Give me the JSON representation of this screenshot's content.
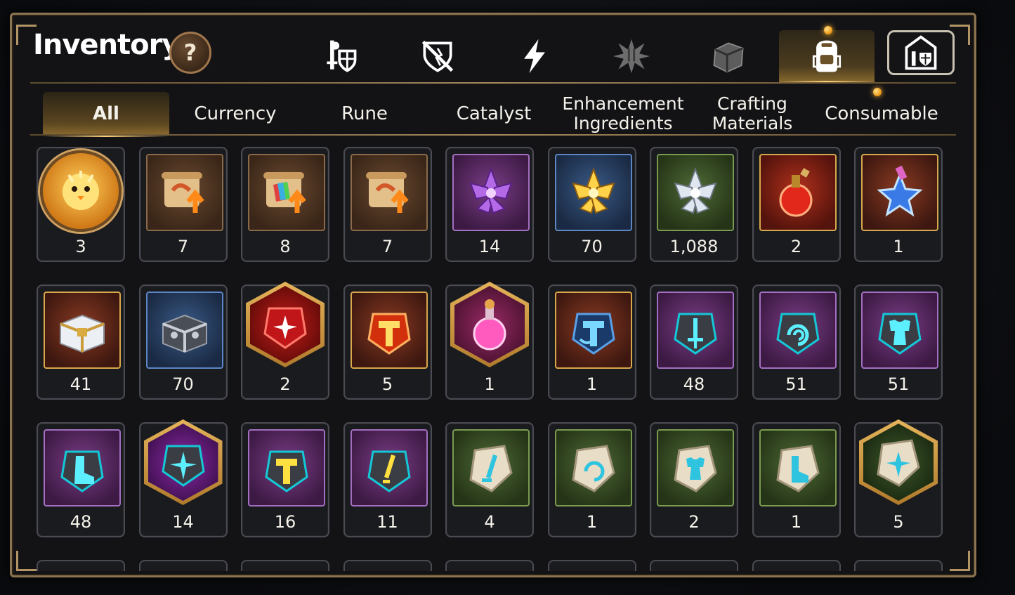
{
  "header": {
    "title": "Inventory",
    "help_label": "?"
  },
  "category_tabs": [
    {
      "name": "heroes",
      "icon": "knight-shield-icon",
      "active": false
    },
    {
      "name": "equipment",
      "icon": "broken-shield-icon",
      "active": false
    },
    {
      "name": "skills",
      "icon": "lightning-icon",
      "active": false
    },
    {
      "name": "effects",
      "icon": "burst-icon",
      "active": false
    },
    {
      "name": "boxes",
      "icon": "cube-icon",
      "active": false
    },
    {
      "name": "bag",
      "icon": "backpack-icon",
      "active": true
    },
    {
      "name": "castle",
      "icon": "castle-icon",
      "active": false
    }
  ],
  "subtabs": [
    {
      "label": "All",
      "active": true
    },
    {
      "label": "Currency",
      "active": false
    },
    {
      "label": "Rune",
      "active": false
    },
    {
      "label": "Catalyst",
      "active": false
    },
    {
      "label": "Enhancement\nIngredients",
      "active": false
    },
    {
      "label": "Crafting\nMaterials",
      "active": false
    },
    {
      "label": "Consumable",
      "active": false
    }
  ],
  "items": [
    {
      "icon": "chick-medal-icon",
      "count": "3",
      "frame": "round"
    },
    {
      "icon": "scroll-upgrade-icon",
      "count": "7",
      "frame": "brown"
    },
    {
      "icon": "rainbow-scroll-icon",
      "count": "8",
      "frame": "brown"
    },
    {
      "icon": "scroll-upgrade-icon",
      "count": "7",
      "frame": "brown"
    },
    {
      "icon": "purple-crystal-flower-icon",
      "count": "14",
      "frame": "purple"
    },
    {
      "icon": "gold-crystal-flower-icon",
      "count": "70",
      "frame": "blue"
    },
    {
      "icon": "silver-crystal-flower-icon",
      "count": "1,088",
      "frame": "green"
    },
    {
      "icon": "red-potion-icon",
      "count": "2",
      "frame": "red"
    },
    {
      "icon": "star-potion-icon",
      "count": "1",
      "frame": "gold"
    },
    {
      "icon": "treasure-chest-icon",
      "count": "41",
      "frame": "gold"
    },
    {
      "icon": "iron-chest-icon",
      "count": "70",
      "frame": "blue"
    },
    {
      "icon": "red-star-gem-icon",
      "count": "2",
      "frame": "hex-red"
    },
    {
      "icon": "hammer-stone-icon",
      "count": "5",
      "frame": "gold"
    },
    {
      "icon": "pink-potion-icon",
      "count": "1",
      "frame": "hex-magenta"
    },
    {
      "icon": "blue-hammer-stone-icon",
      "count": "1",
      "frame": "gold"
    },
    {
      "icon": "sword-rune-icon",
      "count": "48",
      "frame": "purple"
    },
    {
      "icon": "spiral-rune-icon",
      "count": "51",
      "frame": "purple"
    },
    {
      "icon": "armor-rune-icon",
      "count": "51",
      "frame": "purple"
    },
    {
      "icon": "boot-rune-icon",
      "count": "48",
      "frame": "purple"
    },
    {
      "icon": "star-rune-icon",
      "count": "14",
      "frame": "hex-purple"
    },
    {
      "icon": "gold-hammer-rune-icon",
      "count": "16",
      "frame": "purple"
    },
    {
      "icon": "gold-sword-rune-icon",
      "count": "11",
      "frame": "purple"
    },
    {
      "icon": "sword-stone-icon",
      "count": "4",
      "frame": "green"
    },
    {
      "icon": "spiral-stone-icon",
      "count": "1",
      "frame": "green"
    },
    {
      "icon": "armor-stone-icon",
      "count": "2",
      "frame": "green"
    },
    {
      "icon": "boot-stone-icon",
      "count": "1",
      "frame": "green"
    },
    {
      "icon": "star-stone-icon",
      "count": "5",
      "frame": "hex-green"
    }
  ],
  "colors": {
    "panel_border": "#8c7452",
    "active_tab_glow": "#ffd27a",
    "notification": "#f0a020"
  }
}
